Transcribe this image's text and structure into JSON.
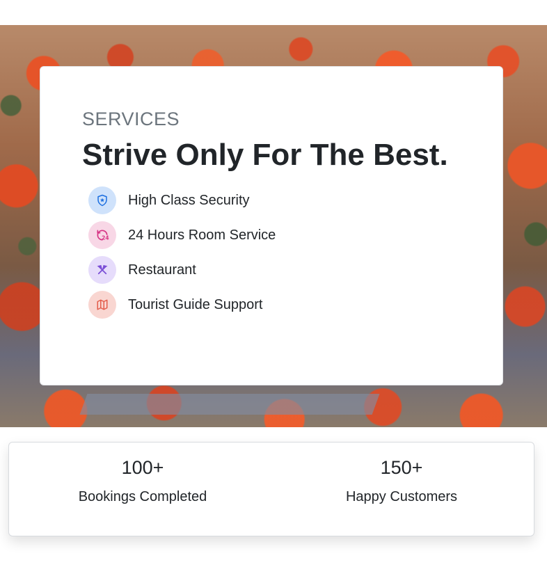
{
  "hero": {
    "image": "red-flowering-forest-background"
  },
  "services": {
    "eyebrow": "SERVICES",
    "headline": "Strive Only For The Best.",
    "features": [
      {
        "label": "High Class Security",
        "icon": "shield-star-icon",
        "icon_color": "#1d6fe0",
        "bg_color": "#cfe2fb"
      },
      {
        "label": "24 Hours Room Service",
        "icon": "clock-24-icon",
        "icon_color": "#d63384",
        "bg_color": "#f8d7e6"
      },
      {
        "label": "Restaurant",
        "icon": "fork-knife-icon",
        "icon_color": "#7b4fd6",
        "bg_color": "#e6dcfb"
      },
      {
        "label": "Tourist Guide Support",
        "icon": "map-icon",
        "icon_color": "#e35d4b",
        "bg_color": "#f9d6d1"
      }
    ]
  },
  "stats": [
    {
      "value": "100+",
      "label": "Bookings Completed"
    },
    {
      "value": "150+",
      "label": "Happy Customers"
    }
  ]
}
